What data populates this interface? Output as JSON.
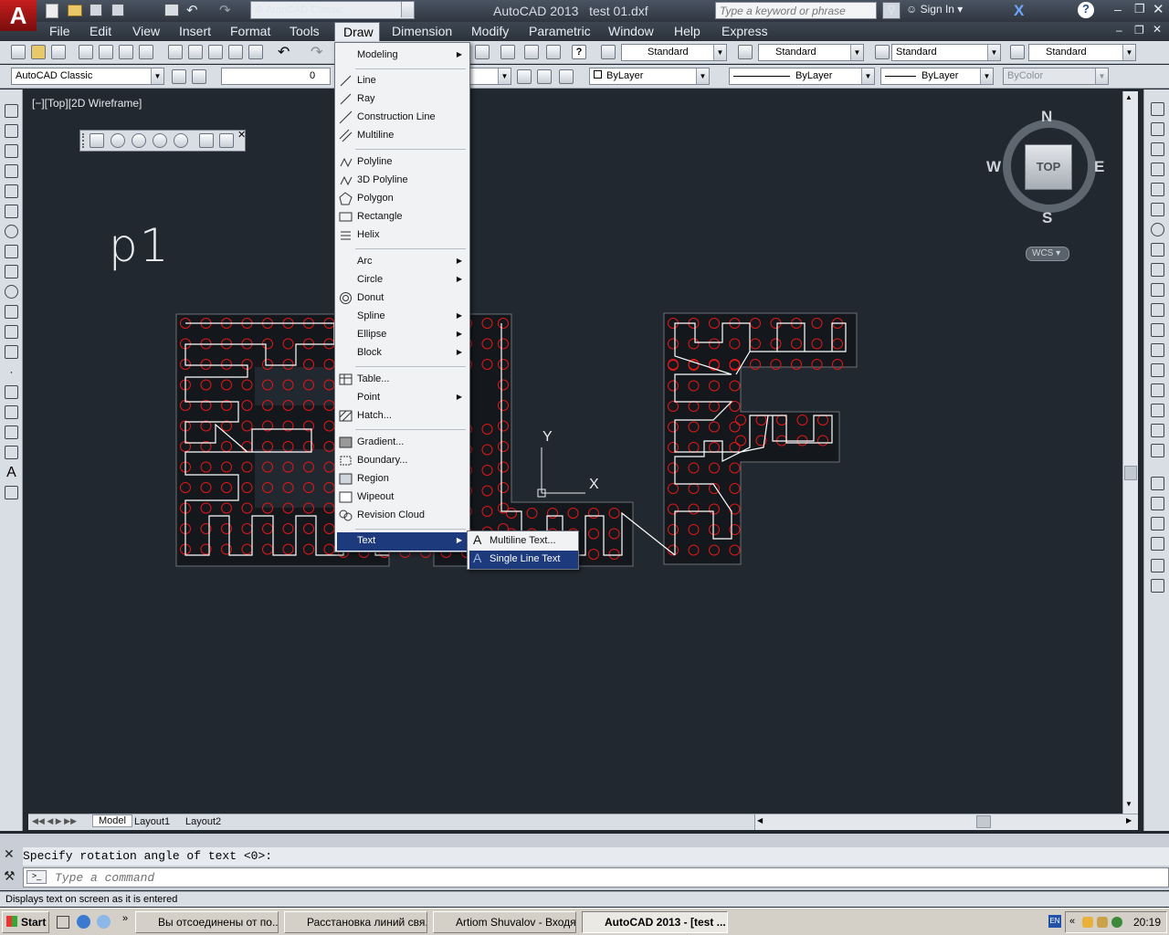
{
  "title": {
    "app_name": "AutoCAD 2013",
    "doc_name": "test 01.dxf",
    "workspace": "AutoCAD Classic",
    "search_placeholder": "Type a keyword or phrase",
    "sign_in": "Sign In"
  },
  "menubar": [
    "File",
    "Edit",
    "View",
    "Insert",
    "Format",
    "Tools",
    "Draw",
    "Dimension",
    "Modify",
    "Parametric",
    "Window",
    "Help",
    "Express"
  ],
  "toolbar1": {
    "text_style": "Standard",
    "dim_style": "Standard",
    "table_style": "Standard",
    "mleader_style": "Standard"
  },
  "toolbar2": {
    "workspace": "AutoCAD Classic",
    "layer": "0",
    "color": "ByLayer",
    "linetype": "ByLayer",
    "lineweight": "ByLayer",
    "plotstyle": "ByColor"
  },
  "viewport": {
    "label": "[−][Top][2D Wireframe]",
    "drawing_text": "p1",
    "ucs_x": "X",
    "ucs_y": "Y"
  },
  "viewcube": {
    "n": "N",
    "s": "S",
    "e": "E",
    "w": "W",
    "face": "TOP",
    "wcs": "WCS"
  },
  "draw_menu": {
    "modeling": "Modeling",
    "line": "Line",
    "ray": "Ray",
    "construction_line": "Construction Line",
    "multiline": "Multiline",
    "polyline": "Polyline",
    "polyline3d": "3D Polyline",
    "polygon": "Polygon",
    "rectangle": "Rectangle",
    "helix": "Helix",
    "arc": "Arc",
    "circle": "Circle",
    "donut": "Donut",
    "spline": "Spline",
    "ellipse": "Ellipse",
    "block": "Block",
    "table": "Table...",
    "point": "Point",
    "hatch": "Hatch...",
    "gradient": "Gradient...",
    "boundary": "Boundary...",
    "region": "Region",
    "wipeout": "Wipeout",
    "revision_cloud": "Revision Cloud",
    "text": "Text"
  },
  "text_submenu": {
    "multiline_text": "Multiline Text...",
    "single_line_text": "Single Line Text"
  },
  "layout_tabs": [
    "Model",
    "Layout1",
    "Layout2"
  ],
  "command": {
    "history": "Specify rotation angle of text <0>:",
    "placeholder": "Type a command"
  },
  "status_text": "Displays text on screen as it is entered",
  "taskbar": {
    "start": "Start",
    "tasks": [
      "Вы отсоединены от по...",
      "Расстановка линий свя...",
      "Artiom Shuvalov - Входя...",
      "AutoCAD 2013 - [test ..."
    ],
    "lang": "EN",
    "clock": "20:19"
  },
  "colors": {
    "canvas": "#212830",
    "accent": "#1d3a7c",
    "hole": "#e01818"
  }
}
